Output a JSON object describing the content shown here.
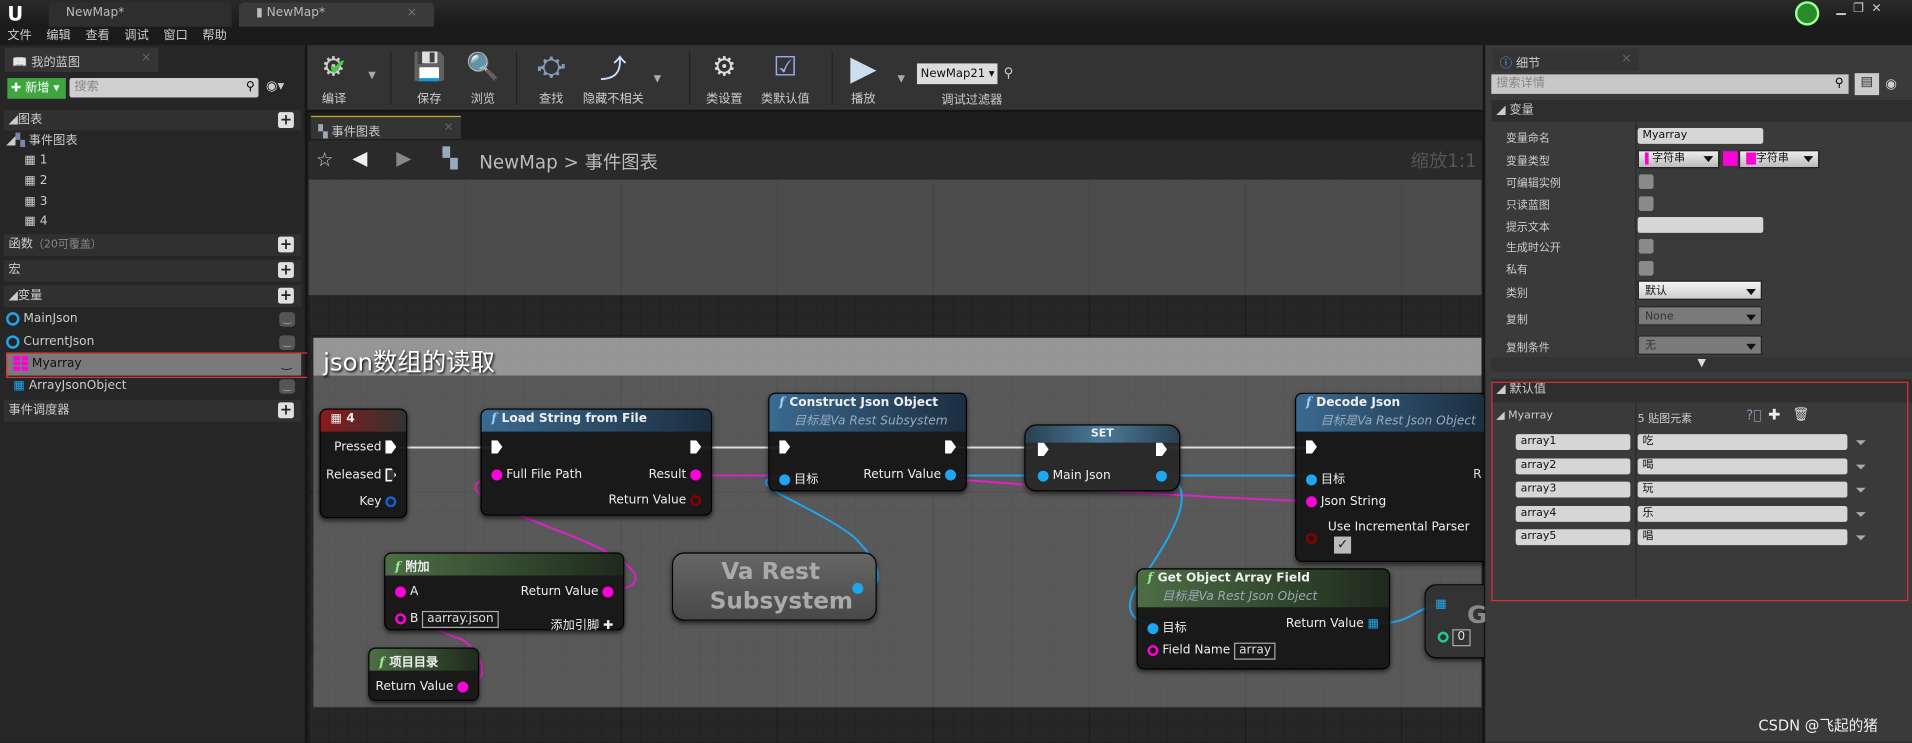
{
  "window": {
    "tabs": [
      "NewMap*",
      "NewMap*"
    ]
  },
  "menu": [
    "文件",
    "编辑",
    "查看",
    "调试",
    "窗口",
    "帮助"
  ],
  "my_blueprint": {
    "tab": "我的蓝图",
    "new_button": "新增",
    "search_placeholder": "搜索",
    "graphs_header": "图表",
    "event_graph": "事件图表",
    "graph_items": [
      "1",
      "2",
      "3",
      "4"
    ],
    "functions_header": "函数",
    "functions_note": "（20可覆盖）",
    "macros_header": "宏",
    "variables_header": "变量",
    "variables": [
      {
        "name": "MainJson",
        "type_color": "#1ea7f0"
      },
      {
        "name": "CurrentJson",
        "type_color": "#1ea7f0"
      },
      {
        "name": "Myarray",
        "type_color": "#ff00d8",
        "selected": true
      },
      {
        "name": "ArrayJsonObject",
        "type_color": "#1ea7f0"
      }
    ],
    "dispatchers_header": "事件调度器"
  },
  "toolbar": {
    "compile": "编译",
    "save": "保存",
    "browse": "浏览",
    "find": "查找",
    "hide_unrelated": "隐藏不相关",
    "class_settings": "类设置",
    "class_defaults": "类默认值",
    "play": "播放",
    "debug_object": "NewMap21",
    "debug_filter": "调试过滤器"
  },
  "graph": {
    "tab": "事件图表",
    "breadcrumb_root": "NewMap",
    "breadcrumb_sep": ">",
    "breadcrumb_current": "事件图表",
    "zoom": "缩放1:1",
    "comment": "json数组的读取",
    "nodes": {
      "key": {
        "title": "4",
        "pins": [
          "Pressed",
          "Released",
          "Key"
        ]
      },
      "load": {
        "title": "Load String from File",
        "pins": [
          "Full File Path",
          "Result",
          "Return Value"
        ]
      },
      "construct": {
        "title": "Construct Json Object",
        "subtitle": "目标是Va Rest Subsystem",
        "pins": [
          "目标",
          "Return Value"
        ]
      },
      "set": {
        "title": "SET",
        "pins": [
          "Main Json"
        ]
      },
      "decode": {
        "title": "Decode Json",
        "subtitle": "目标是Va Rest Json Object",
        "pins": [
          "目标",
          "Json String",
          "Use Incremental Parser"
        ],
        "partial_right": "R"
      },
      "append": {
        "title": "附加",
        "pins": [
          "A",
          "B",
          "Return Value"
        ],
        "b_value": "aarray.json",
        "add_pin": "添加引脚"
      },
      "subsystem": {
        "title": "Va Rest Subsystem"
      },
      "project_dir": {
        "title": "项目目录",
        "pins": [
          "Return Value"
        ]
      },
      "get_array": {
        "title": "Get Object Array Field",
        "subtitle": "目标是Va Rest Json Object",
        "pins": [
          "目标",
          "Field Name",
          "Return Value"
        ],
        "field_value": "array"
      },
      "partial": {
        "title": "G",
        "index": "0"
      }
    }
  },
  "details": {
    "tab": "细节",
    "search_placeholder": "搜索详情",
    "variable_header": "变量",
    "rows": [
      {
        "label": "变量命名",
        "value": "Myarray"
      },
      {
        "label": "变量类型",
        "value": "字符串",
        "value2": "字符串"
      },
      {
        "label": "可编辑实例"
      },
      {
        "label": "只读蓝图"
      },
      {
        "label": "提示文本",
        "value": ""
      },
      {
        "label": "生成时公开"
      },
      {
        "label": "私有"
      },
      {
        "label": "类别",
        "value": "默认"
      },
      {
        "label": "复制",
        "value": "None"
      },
      {
        "label": "复制条件",
        "value": "无"
      }
    ],
    "defaults_header": "默认值",
    "array_name": "Myarray",
    "array_count": "5 贴图元素",
    "elements": [
      {
        "key": "array1",
        "value": "吃"
      },
      {
        "key": "array2",
        "value": "喝"
      },
      {
        "key": "array3",
        "value": "玩"
      },
      {
        "key": "array4",
        "value": "乐"
      },
      {
        "key": "array5",
        "value": "唱"
      }
    ]
  },
  "watermark": "CSDN @飞起的猪",
  "colors": {
    "string_pin": "#ff00d8",
    "object_pin": "#1ea7f0",
    "highlight_box": "#e03030"
  }
}
